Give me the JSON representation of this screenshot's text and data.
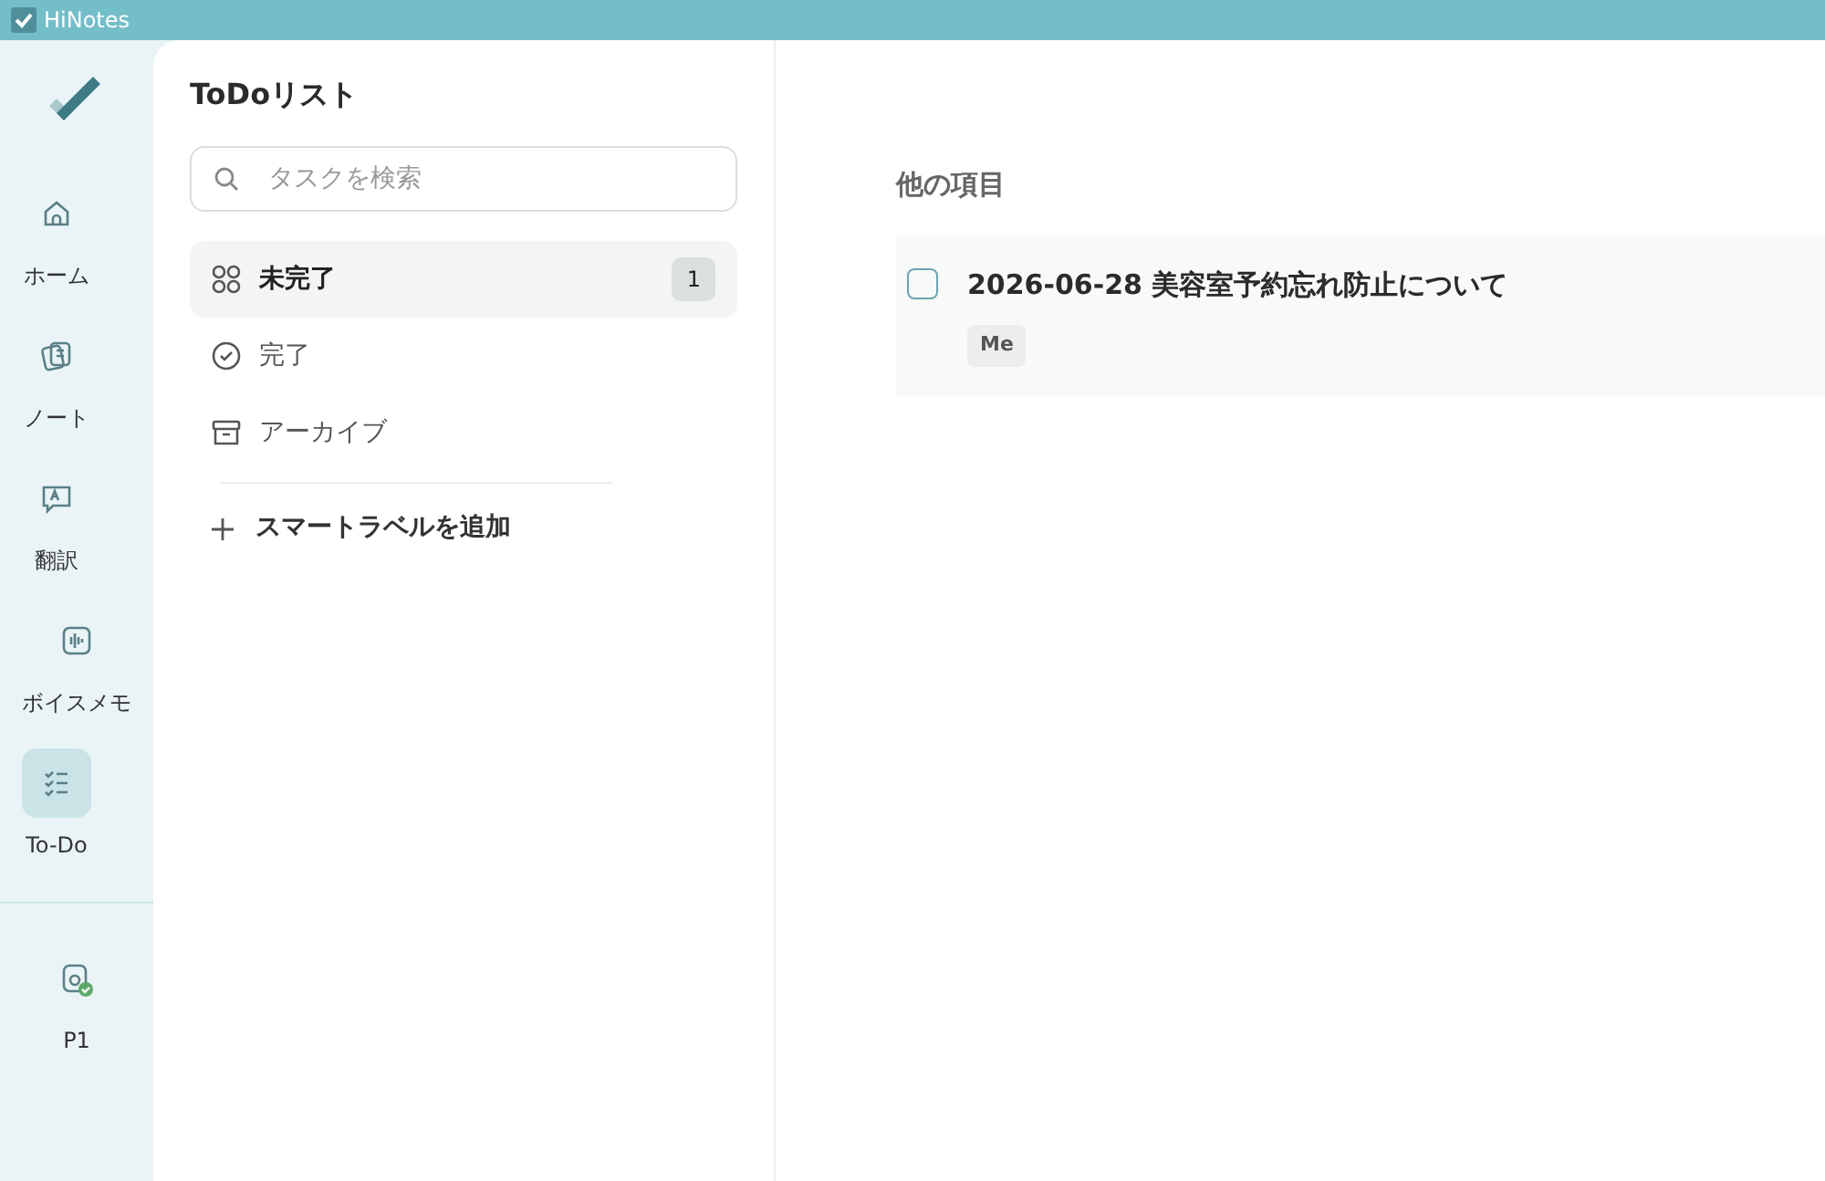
{
  "window": {
    "title": "HiNotes"
  },
  "nav": [
    {
      "kind": "home",
      "label": "ホーム",
      "selected": false
    },
    {
      "kind": "notes",
      "label": "ノート",
      "selected": false
    },
    {
      "kind": "translate",
      "label": "翻訳",
      "selected": false
    },
    {
      "kind": "voice",
      "label": "ボイスメモ",
      "selected": false
    },
    {
      "kind": "todo",
      "label": "To-Do",
      "selected": true
    }
  ],
  "device": {
    "label": "P1",
    "connected": true
  },
  "panel": {
    "title": "ToDoリスト",
    "search": {
      "placeholder": "タスクを検索"
    },
    "filters": [
      {
        "kind": "incomplete",
        "label": "未完了",
        "count": "1",
        "selected": true
      },
      {
        "kind": "done",
        "label": "完了",
        "selected": false
      },
      {
        "kind": "archive",
        "label": "アーカイブ",
        "selected": false
      }
    ],
    "add_label": "スマートラベルを追加"
  },
  "main": {
    "section": "他の項目",
    "tasks": [
      {
        "title": "2026-06-28 美容室予約忘れ防止について",
        "checked": false,
        "tag": "Me"
      }
    ]
  }
}
